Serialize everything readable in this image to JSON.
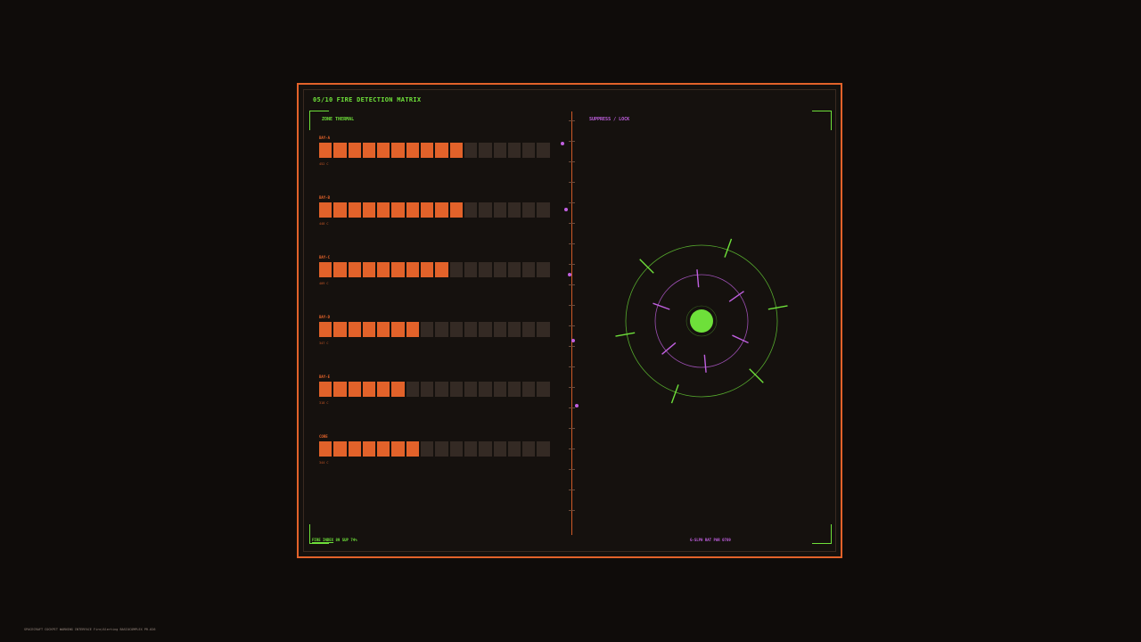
{
  "panel": {
    "number": "05/10",
    "title": "FIRE DETECTION MATRIX",
    "zone_label": "ZONE THERMAL",
    "suppress_label": "SUPPRESS / LOCK"
  },
  "bays": [
    {
      "label": "BAY-A",
      "temp": "452 C",
      "level": 10,
      "total": 16
    },
    {
      "label": "BAY-B",
      "temp": "448 C",
      "level": 10,
      "total": 16
    },
    {
      "label": "BAY-C",
      "temp": "409 C",
      "level": 9,
      "total": 16
    },
    {
      "label": "BAY-D",
      "temp": "347 C",
      "level": 7,
      "total": 16
    },
    {
      "label": "BAY-E",
      "temp": "318 C",
      "level": 6,
      "total": 16
    },
    {
      "label": "CORE",
      "temp": "344 C",
      "level": 7,
      "total": 16
    }
  ],
  "footer": {
    "left_prefix": "FIRE INDEX",
    "left_values": "89  SUP 74%",
    "right": "G-SLPH RAT PAR  0789"
  },
  "caption": "SPACECRAFT COCKPIT WARNING INTERFACE  Fire/Alerting  BASIOCOMPLEX  PR-026",
  "colors": {
    "accent_orange": "#e2622a",
    "accent_green": "#6ee03a",
    "accent_magenta": "#c060e0",
    "segment_off": "#342a24"
  }
}
